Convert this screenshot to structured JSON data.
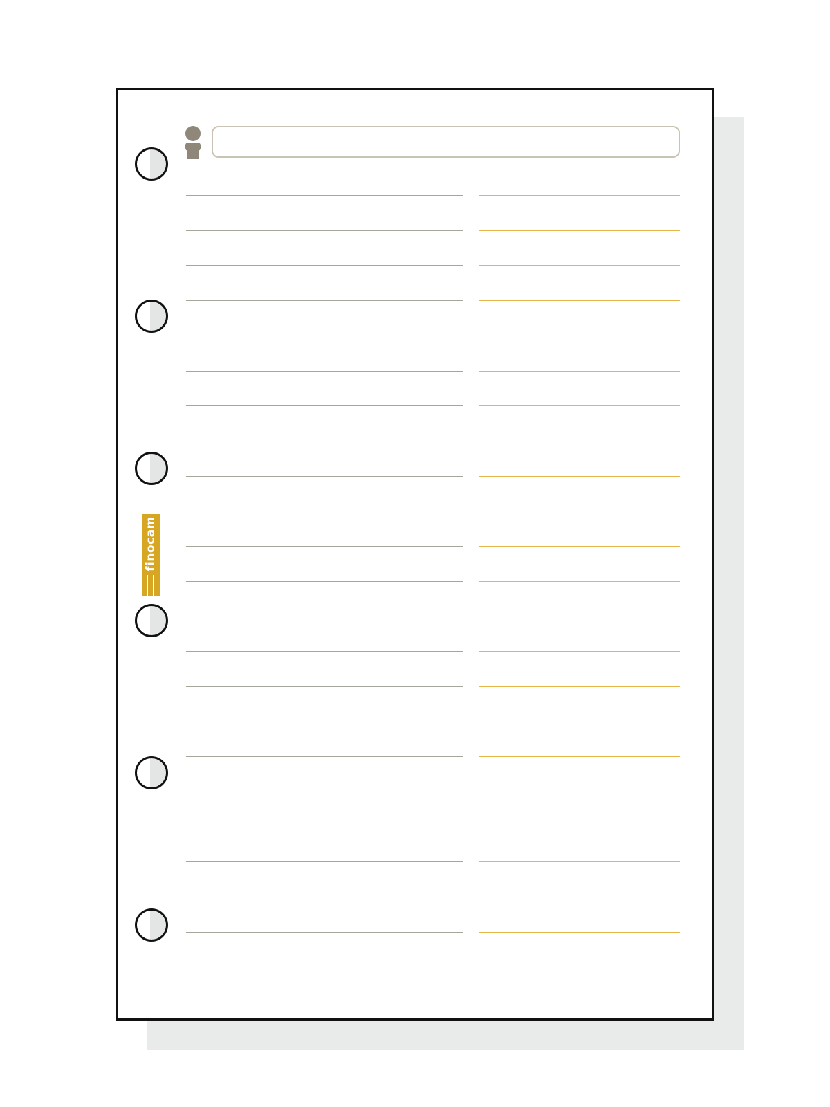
{
  "page": {
    "background": "#ffffff",
    "shadow_color": "#e9eaea",
    "sheet_border_color": "#111111"
  },
  "header": {
    "icon": "person-icon",
    "icon_color": "#8f887a",
    "name_value": "",
    "field_border_color": "#c9c3b3"
  },
  "binder_holes": {
    "count": 6
  },
  "ruled_columns": {
    "left_line_count": 23,
    "right_line_count": 23,
    "left_line_color": "#a7a69c",
    "right_line_color": "#e6b64a"
  },
  "brand": {
    "text": "finocam",
    "color": "#d7a623",
    "logo": "finocam-stripes-logo"
  }
}
